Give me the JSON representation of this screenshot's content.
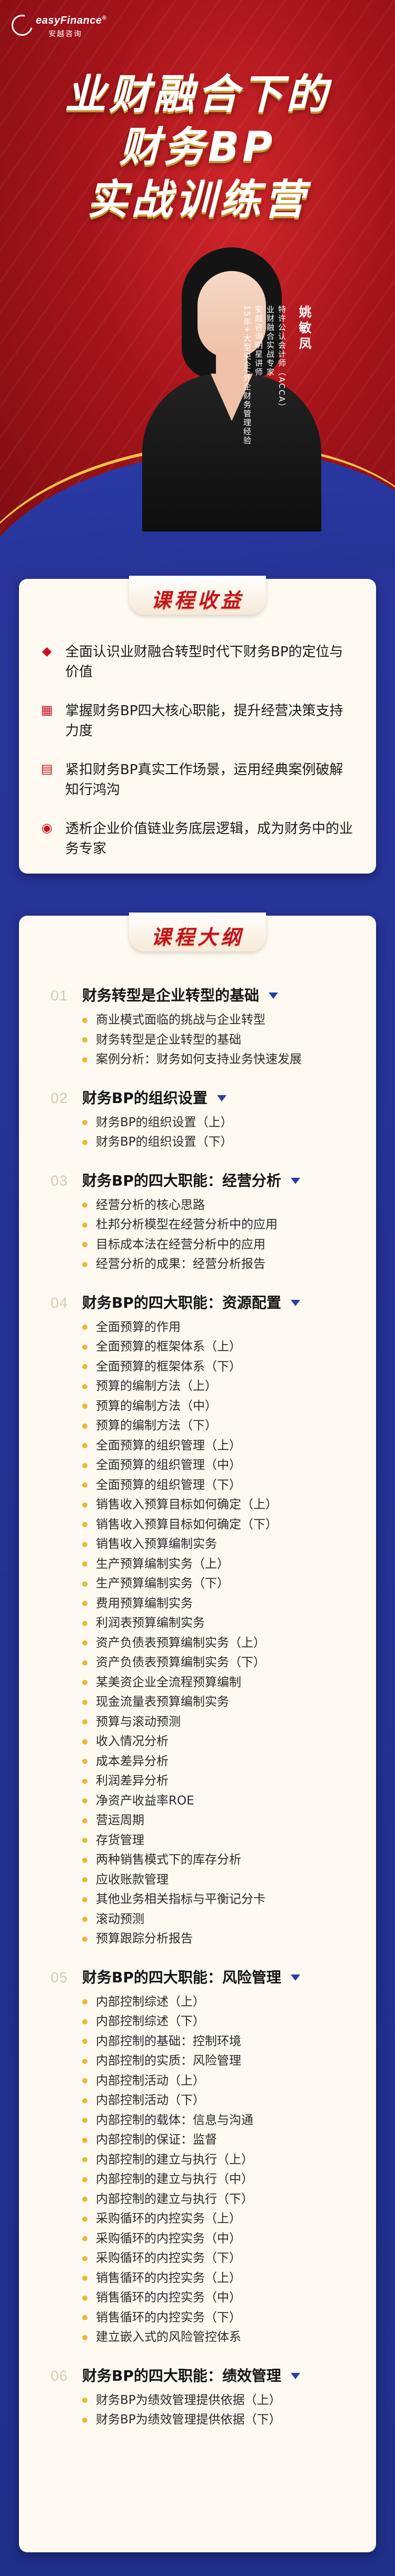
{
  "brand": {
    "logo_en": "easyFinance",
    "logo_cn": "安越咨询",
    "trademark": "®"
  },
  "hero": {
    "title_lines": [
      "业财融合下的",
      "财务BP",
      "实战训练营"
    ],
    "teacher_name": "姚敏凤",
    "teacher_creds": [
      "特许公认会计师（ACCA）",
      "业财融合实战专家",
      "安越咨询明星讲师",
      "15年+大型央企/外企财务管理经验"
    ]
  },
  "colors": {
    "brand_red": "#c1141d",
    "brand_blue": "#1f2f8a",
    "gold": "#e8b83a"
  },
  "benefits": {
    "heading": "课程收益",
    "items": [
      {
        "icon": "diamond-icon",
        "text": "全面认识业财融合转型时代下财务BP的定位与价值"
      },
      {
        "icon": "grid-icon",
        "text": "掌握财务BP四大核心职能，提升经营决策支持力度"
      },
      {
        "icon": "chart-icon",
        "text": "紧扣财务BP真实工作场景，运用经典案例破解知行鸿沟"
      },
      {
        "icon": "lightbulb-icon",
        "text": "透析企业价值链业务底层逻辑，成为财务中的业务专家"
      }
    ]
  },
  "outline": {
    "heading": "课程大纲",
    "sections": [
      {
        "num": "01",
        "title": "财务转型是企业转型的基础",
        "items": [
          "商业模式面临的挑战与企业转型",
          "财务转型是企业转型的基础",
          "案例分析：财务如何支持业务快速发展"
        ]
      },
      {
        "num": "02",
        "title": "财务BP的组织设置",
        "items": [
          "财务BP的组织设置（上）",
          "财务BP的组织设置（下）"
        ]
      },
      {
        "num": "03",
        "title": "财务BP的四大职能：经营分析",
        "items": [
          "经营分析的核心思路",
          "杜邦分析模型在经营分析中的应用",
          "目标成本法在经营分析中的应用",
          "经营分析的成果：经营分析报告"
        ]
      },
      {
        "num": "04",
        "title": "财务BP的四大职能：资源配置",
        "items": [
          "全面预算的作用",
          "全面预算的框架体系（上）",
          "全面预算的框架体系（下）",
          "预算的编制方法（上）",
          "预算的编制方法（中）",
          "预算的编制方法（下）",
          "全面预算的组织管理（上）",
          "全面预算的组织管理（中）",
          "全面预算的组织管理（下）",
          "销售收入预算目标如何确定（上）",
          "销售收入预算目标如何确定（下）",
          "销售收入预算编制实务",
          "生产预算编制实务（上）",
          "生产预算编制实务（下）",
          "费用预算编制实务",
          "利润表预算编制实务",
          "资产负债表预算编制实务（上）",
          "资产负债表预算编制实务（下）",
          "某美资企业全流程预算编制",
          "现金流量表预算编制实务",
          "预算与滚动预测",
          "收入情况分析",
          "成本差异分析",
          "利润差异分析",
          "净资产收益率ROE",
          "营运周期",
          "存货管理",
          "两种销售模式下的库存分析",
          "应收账款管理",
          "其他业务相关指标与平衡记分卡",
          "滚动预测",
          "预算跟踪分析报告"
        ]
      },
      {
        "num": "05",
        "title": "财务BP的四大职能：风险管理",
        "items": [
          "内部控制综述（上）",
          "内部控制综述（下）",
          "内部控制的基础：控制环境",
          "内部控制的实质：风险管理",
          "内部控制活动（上）",
          "内部控制活动（下）",
          "内部控制的载体：信息与沟通",
          "内部控制的保证：监督",
          "内部控制的建立与执行（上）",
          "内部控制的建立与执行（中）",
          "内部控制的建立与执行（下）",
          "采购循环的内控实务（上）",
          "采购循环的内控实务（中）",
          "采购循环的内控实务（下）",
          "销售循环的内控实务（上）",
          "销售循环的内控实务（中）",
          "销售循环的内控实务（下）",
          "建立嵌入式的风险管控体系"
        ]
      },
      {
        "num": "06",
        "title": "财务BP的四大职能：绩效管理",
        "items": [
          "财务BP为绩效管理提供依据（上）",
          "财务BP为绩效管理提供依据（下）"
        ]
      }
    ]
  }
}
